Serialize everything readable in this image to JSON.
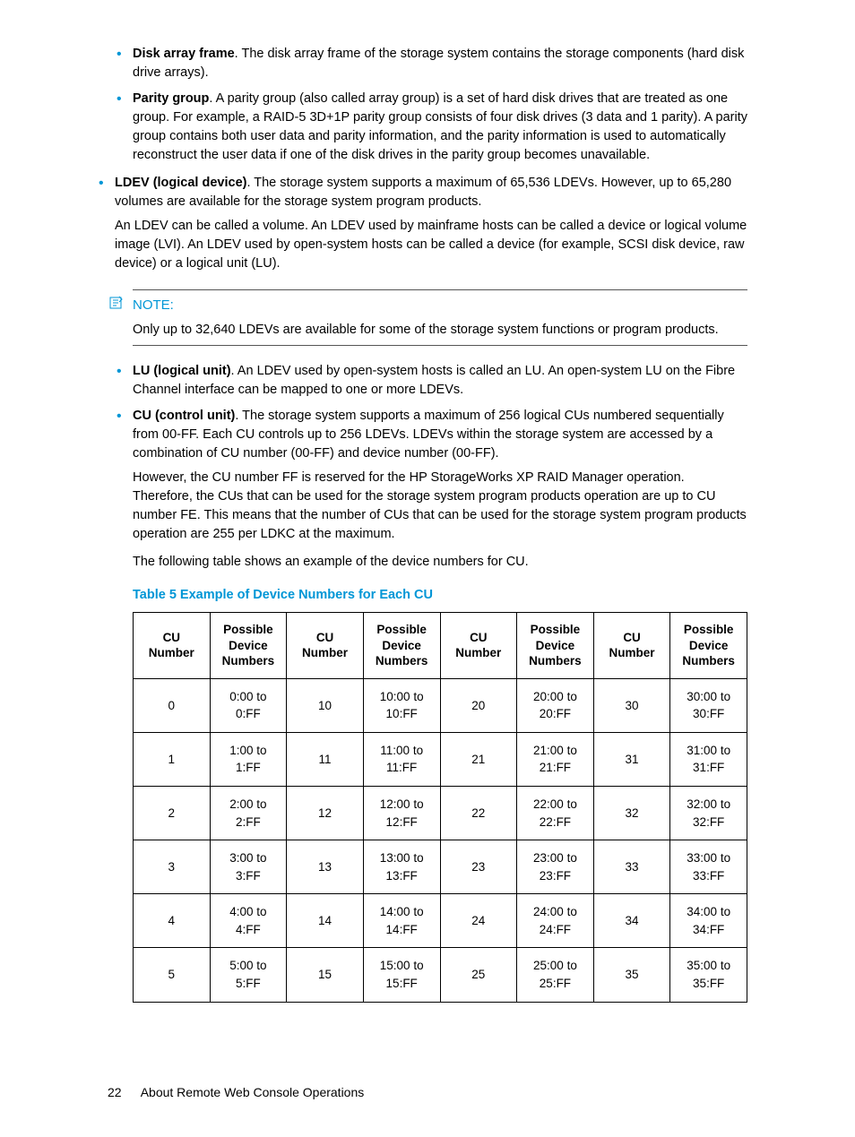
{
  "bullets1": [
    {
      "term": "Disk array frame",
      "text": ". The disk array frame of the storage system contains the storage components (hard disk drive arrays)."
    },
    {
      "term": "Parity group",
      "text": ". A parity group (also called array group) is a set of hard disk drives that are treated as one group. For example, a RAID-5 3D+1P parity group  consists of four disk drives (3 data and 1 parity). A parity group contains both user data and parity information, and the parity information is used to automatically reconstruct the user data if one of the disk drives in the parity group becomes unavailable."
    }
  ],
  "ldev": {
    "term": "LDEV (logical device)",
    "text": ". The storage system supports a maximum of 65,536 LDEVs. However, up to 65,280 volumes are available for the storage system program products.",
    "cont": "An LDEV can be called a volume. An LDEV used by mainframe hosts can be called a device or logical volume image (LVI). An LDEV used by open-system hosts can be called a device (for example, SCSI disk device, raw device) or a logical unit (LU)."
  },
  "note": {
    "title": "NOTE:",
    "body": "Only up to 32,640 LDEVs are available for some of the storage system functions or program products."
  },
  "bullets2": [
    {
      "term": "LU (logical unit)",
      "text": ". An LDEV used by open-system hosts is called an LU. An open-system LU on the Fibre Channel interface can be mapped to one or more LDEVs."
    }
  ],
  "cu": {
    "term": "CU (control unit)",
    "text": ". The storage system supports a maximum of 256 logical CUs numbered sequentially from 00-FF. Each CU controls up to 256 LDEVs. LDEVs within the storage system are accessed by a combination of CU number (00-FF) and device number (00-FF).",
    "cont1": "However, the CU number FF is reserved for the HP StorageWorks XP RAID Manager operation. Therefore, the CUs that can be used for the storage system program products operation are up to CU number FE. This means that the number of CUs that can be used for the storage system program products operation are 255 per LDKC at the maximum.",
    "cont2": "The following table shows an example of the device numbers for CU."
  },
  "tableTitle": "Table 5 Example of Device Numbers for Each CU",
  "headers": {
    "cu": "CU Number",
    "dev": "Possible Device Numbers"
  },
  "rows": [
    [
      "0",
      "0:00 to 0:FF",
      "10",
      "10:00 to 10:FF",
      "20",
      "20:00 to 20:FF",
      "30",
      "30:00 to 30:FF"
    ],
    [
      "1",
      "1:00 to 1:FF",
      "11",
      "11:00 to 11:FF",
      "21",
      "21:00 to 21:FF",
      "31",
      "31:00 to 31:FF"
    ],
    [
      "2",
      "2:00 to 2:FF",
      "12",
      "12:00 to 12:FF",
      "22",
      "22:00 to 22:FF",
      "32",
      "32:00 to 32:FF"
    ],
    [
      "3",
      "3:00 to 3:FF",
      "13",
      "13:00 to 13:FF",
      "23",
      "23:00 to 23:FF",
      "33",
      "33:00 to 33:FF"
    ],
    [
      "4",
      "4:00 to 4:FF",
      "14",
      "14:00 to 14:FF",
      "24",
      "24:00 to 24:FF",
      "34",
      "34:00 to 34:FF"
    ],
    [
      "5",
      "5:00 to 5:FF",
      "15",
      "15:00 to 15:FF",
      "25",
      "25:00 to 25:FF",
      "35",
      "35:00 to 35:FF"
    ]
  ],
  "footer": {
    "page": "22",
    "section": "About Remote Web Console Operations"
  }
}
